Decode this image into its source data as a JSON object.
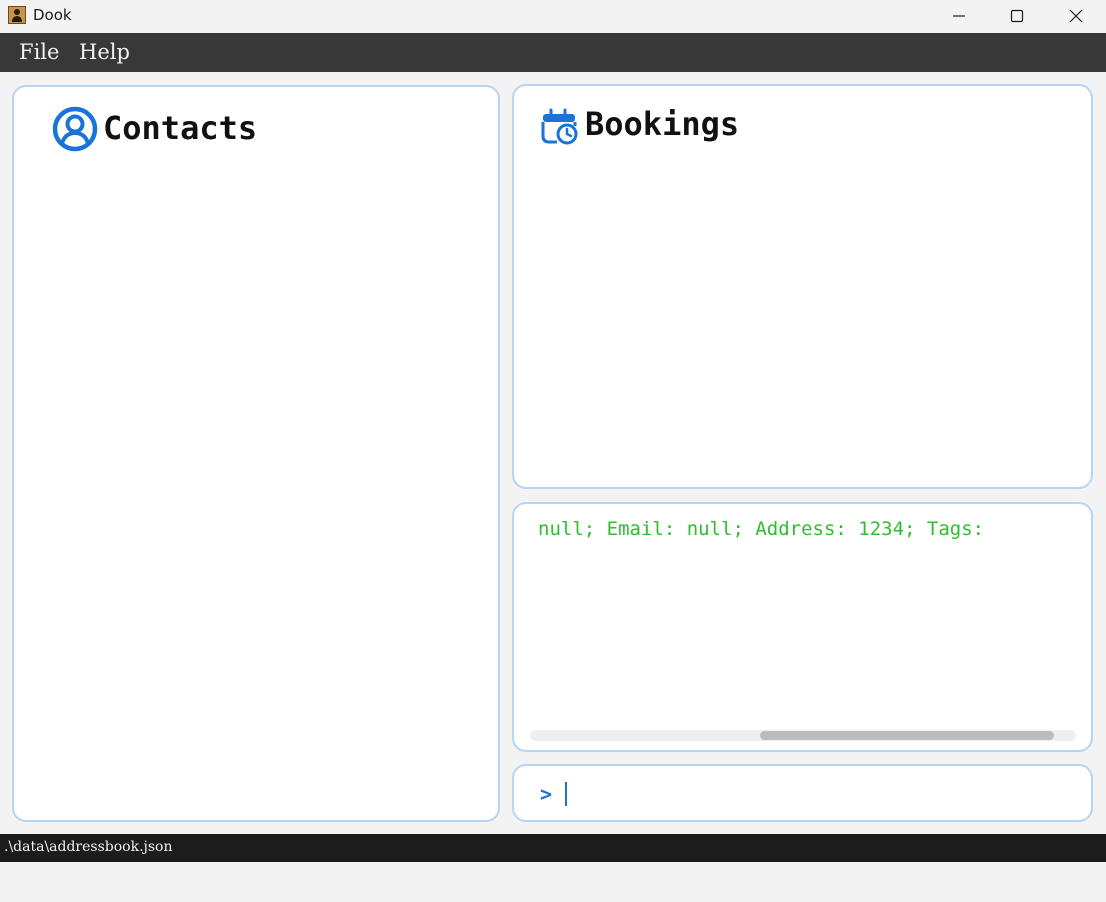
{
  "window": {
    "title": "Dook"
  },
  "menu": {
    "items": [
      {
        "label": "File"
      },
      {
        "label": "Help"
      }
    ]
  },
  "contacts": {
    "title": "Contacts",
    "icon": "user-circle-icon"
  },
  "bookings": {
    "title": "Bookings",
    "icon": "calendar-clock-icon"
  },
  "result": {
    "text": "null; Email: null; Address: 1234; Tags:"
  },
  "command": {
    "prompt": ">",
    "value": ""
  },
  "status": {
    "path": ".\\data\\addressbook.json"
  },
  "colors": {
    "accent": "#1a73d9",
    "result_text": "#2dbf2d",
    "panel_border": "#b7d4f5",
    "menubar": "#383838",
    "statusbar": "#1c1c1c"
  }
}
